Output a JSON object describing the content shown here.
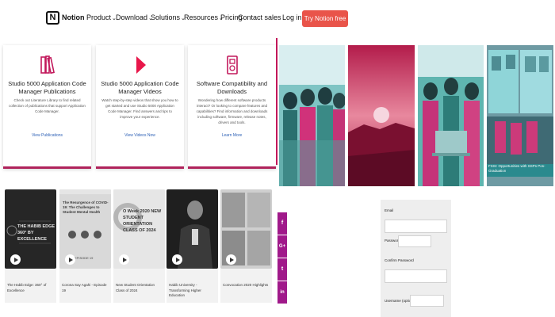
{
  "nav": {
    "brand": "Notion",
    "links": {
      "product": "Product",
      "download": "Download",
      "solutions": "Solutions",
      "resources": "Resources",
      "pricing": "Pricing",
      "contact": "Contact sales",
      "login": "Log in"
    },
    "cta": "Try Notion free",
    "cta_color": "#e9544a"
  },
  "cards": [
    {
      "icon": "books-icon",
      "title": "Studio 5000 Application Code Manager Publications",
      "desc": "Check out Literature Library to find related collection of publications that support Application Code Manager.",
      "link": "View Publications"
    },
    {
      "icon": "play-icon",
      "title": "Studio 5000 Application Code Manager Videos",
      "desc": "Watch step-by-step videos that show you how to get started and use Studio 5000 Application Code Manager. Find answers and tips to improve your experience.",
      "link": "View Videos Now"
    },
    {
      "icon": "downloads-icon",
      "title": "Software Compatibility and Downloads",
      "desc": "Wondering how different software products interact? Or looking to compare features and capabilities? Find information and downloads including software, firmware, release notes, drivers and tools.",
      "link": "Learn More"
    }
  ],
  "photo_caption": "FSSI: Opportunities with SSPs Pos-Graduation",
  "videos": [
    {
      "thumb_title": "THE HABIB EDGE 360° BY EXCELLENCE",
      "caption": "The Habib Edge: 360° of Excellence"
    },
    {
      "thumb_title": "The Resurgence of COVID-19: The Challenges to Student Mental Health",
      "episode": "EPISODE 19",
      "caption": "Corona Say Agahi - Episode 19"
    },
    {
      "thumb_title": "O Week 2020 NEW STUDENT ORIENTATION CLASS OF 2024",
      "caption": "New Student Orientation Class of 2024"
    },
    {
      "thumb_title": "",
      "caption": "Habib University - Transforming Higher Education"
    },
    {
      "thumb_title": "",
      "caption": "Convocation 2020 Highlights"
    }
  ],
  "social": [
    "f",
    "G+",
    "t",
    "in"
  ],
  "form": {
    "email_label": "Email",
    "password_label": "Password",
    "confirm_label": "Confirm Password",
    "username_label": "Username (optional)"
  },
  "colors": {
    "accent": "#b0235b",
    "social": "#a0198a",
    "link": "#2b5fb5"
  }
}
